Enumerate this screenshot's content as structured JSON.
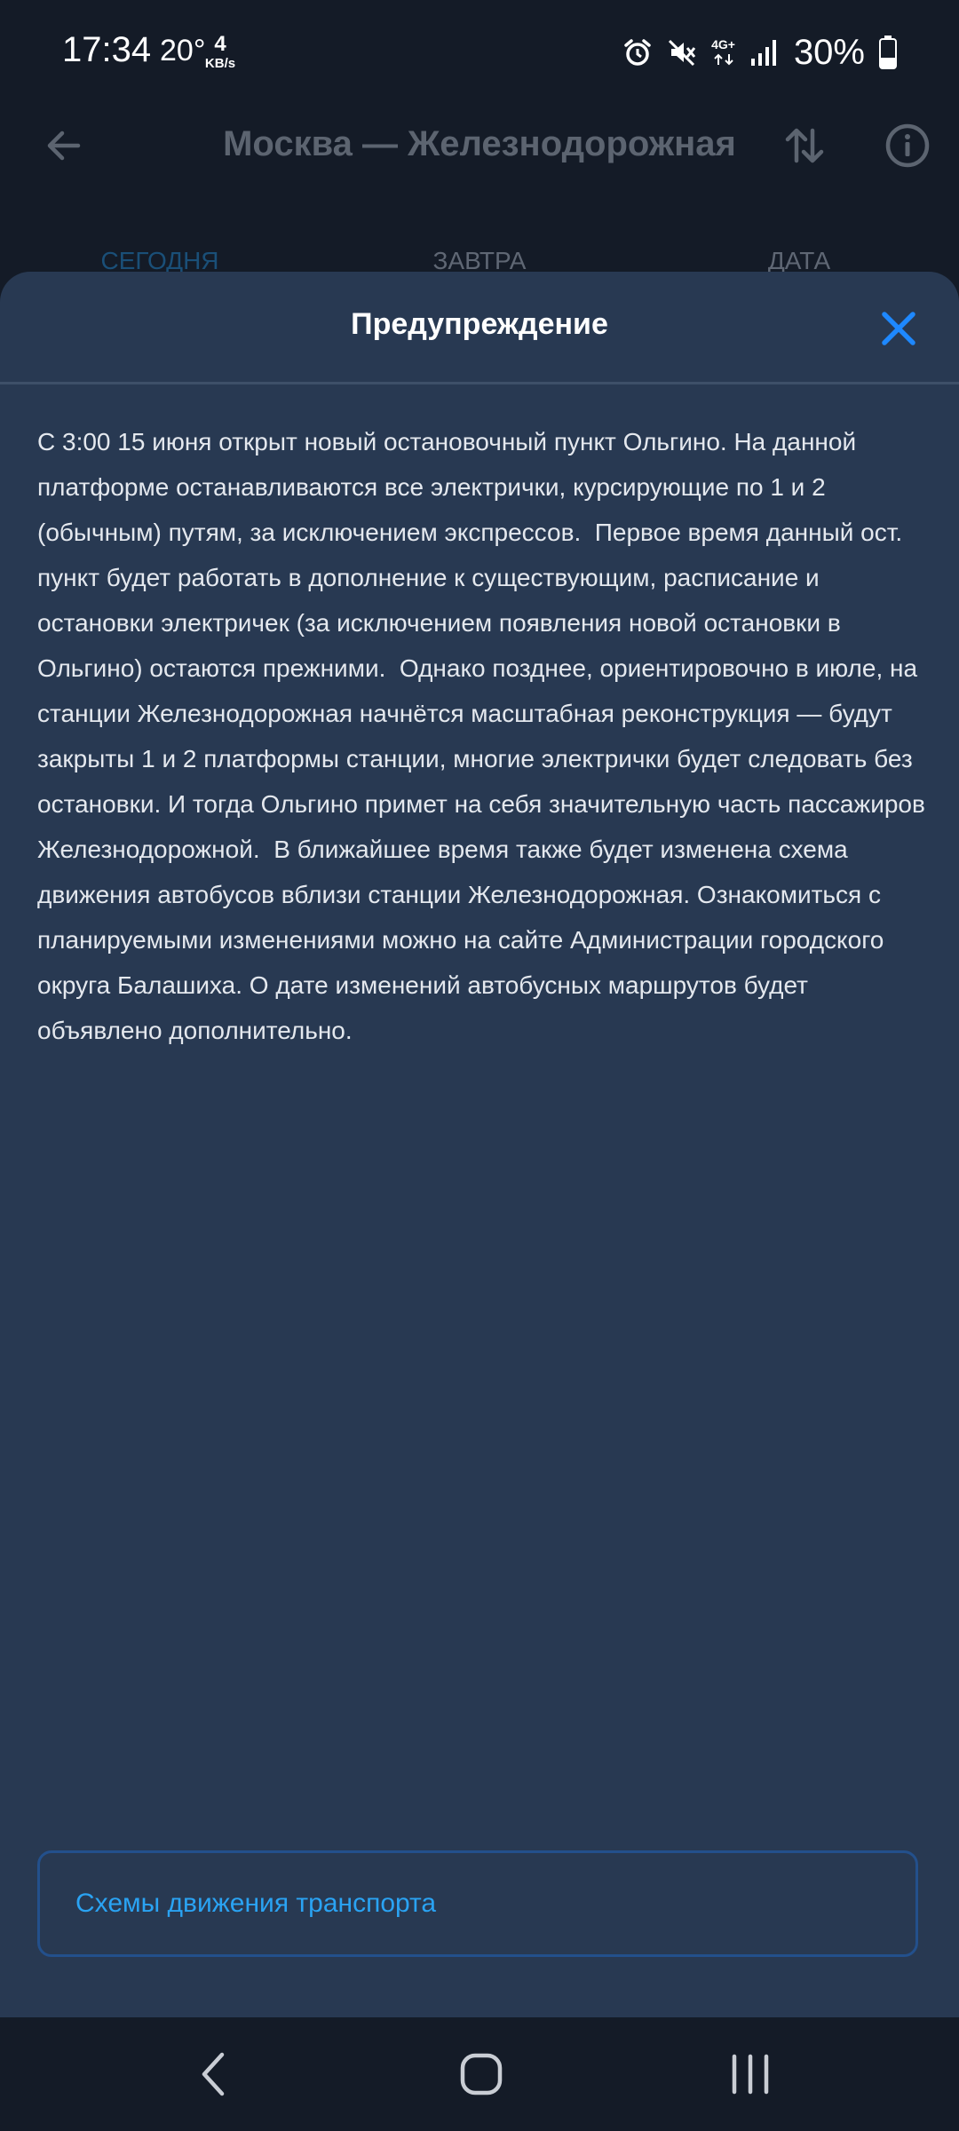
{
  "status_bar": {
    "time": "17:34",
    "temperature": "20°",
    "data_speed_value": "4",
    "data_speed_unit": "KB/s",
    "network_type": "4G+",
    "battery_percent": "30%"
  },
  "app_bar": {
    "title": "Москва — Железнодорожная",
    "back_icon": "arrow-left-icon",
    "swap_icon": "swap-vertical-icon",
    "info_icon": "info-icon"
  },
  "tabs": [
    {
      "label": "СЕГОДНЯ",
      "active": true
    },
    {
      "label": "ЗАВТРА",
      "active": false
    },
    {
      "label": "ДАТА",
      "active": false
    }
  ],
  "dialog": {
    "title": "Предупреждение",
    "close_icon": "close-icon",
    "message": "С 3:00 15 июня открыт новый остановочный пункт Ольгино. На данной платформе останавливаются все электрички, курсирующие по 1 и 2 (обычным) путям, за исключением экспрессов.  Первое время данный ост. пункт будет работать в дополнение к существующим, расписание и остановки электричек (за исключением появления новой остановки в Ольгино) остаются прежними.  Однако позднее, ориентировочно в июле, на станции Железнодорожная начнётся масштабная реконструкция — будут закрыты 1 и 2 платформы станции, многие электрички будет следовать без остановки. И тогда Ольгино примет на себя значительную часть пассажиров Железнодорожной.  В ближайшее время также будет изменена схема движения автобусов вблизи станции Железнодорожная. Ознакомиться с планируемыми изменениями можно на сайте Администрации городского округа Балашиха. О дате изменений автобусных маршрутов будет объявлено дополнительно.",
    "link_button_label": "Схемы движения транспорта"
  },
  "colors": {
    "background": "#141b27",
    "sheet": "#283952",
    "accent": "#2aa3f3",
    "close": "#1e88ff"
  }
}
